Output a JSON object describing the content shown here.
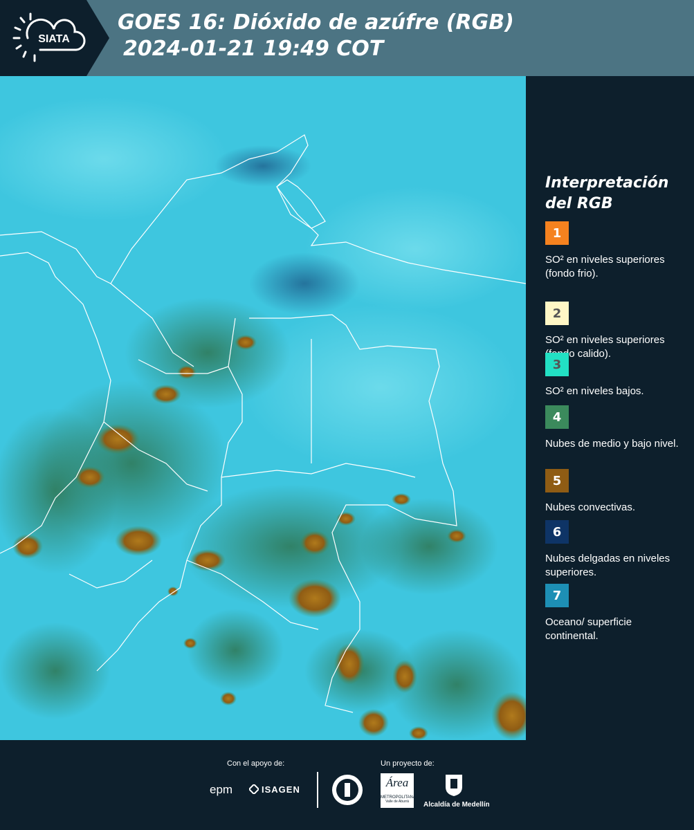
{
  "header": {
    "logo_text": "SIATA",
    "title_line1": "GOES 16: Dióxido de azúfre (RGB)",
    "title_line2": " 2024-01-21 19:49 COT"
  },
  "legend": {
    "title": "Interpretación del RGB",
    "items": [
      {
        "number": "1",
        "color": "#f5821f",
        "num_color": "#ffffff",
        "text": "SO² en niveles superiores (fondo frio)."
      },
      {
        "number": "2",
        "color": "#fff7c6",
        "num_color": "#555555",
        "text": "SO² en niveles superiores (fondo calido)."
      },
      {
        "number": "3",
        "color": "#22e0c4",
        "num_color": "#555555",
        "text": "SO² en niveles bajos."
      },
      {
        "number": "4",
        "color": "#3b8a5c",
        "num_color": "#ffffff",
        "text": "Nubes de medio y bajo nivel."
      },
      {
        "number": "5",
        "color": "#8f5c14",
        "num_color": "#ffffff",
        "text": "Nubes convectivas."
      },
      {
        "number": "6",
        "color": "#0e3466",
        "num_color": "#ffffff",
        "text": "Nubes delgadas en niveles superiores."
      },
      {
        "number": "7",
        "color": "#1d8fb5",
        "num_color": "#ffffff",
        "text": "Oceano/ superficie continental."
      }
    ]
  },
  "footer": {
    "support_label": "Con el apoyo de:",
    "project_label": "Un proyecto de:",
    "sponsors": [
      "epm",
      "ISAGEN"
    ],
    "partners": [
      "Área Metropolitana Valle de Aburrá",
      "Alcaldía de Medellín"
    ],
    "epm_text": "epm",
    "isagen_text": "ISAGEN",
    "area_text": "Área",
    "area_sub1": "METROPOLITANA",
    "area_sub2": "Valle de Aburrá",
    "alcaldia_text": "Alcaldía de Medellín"
  },
  "colors": {
    "header_bg": "#4c7483",
    "panel_bg": "#0d1f2c",
    "map_base": "#3ec8e0"
  }
}
